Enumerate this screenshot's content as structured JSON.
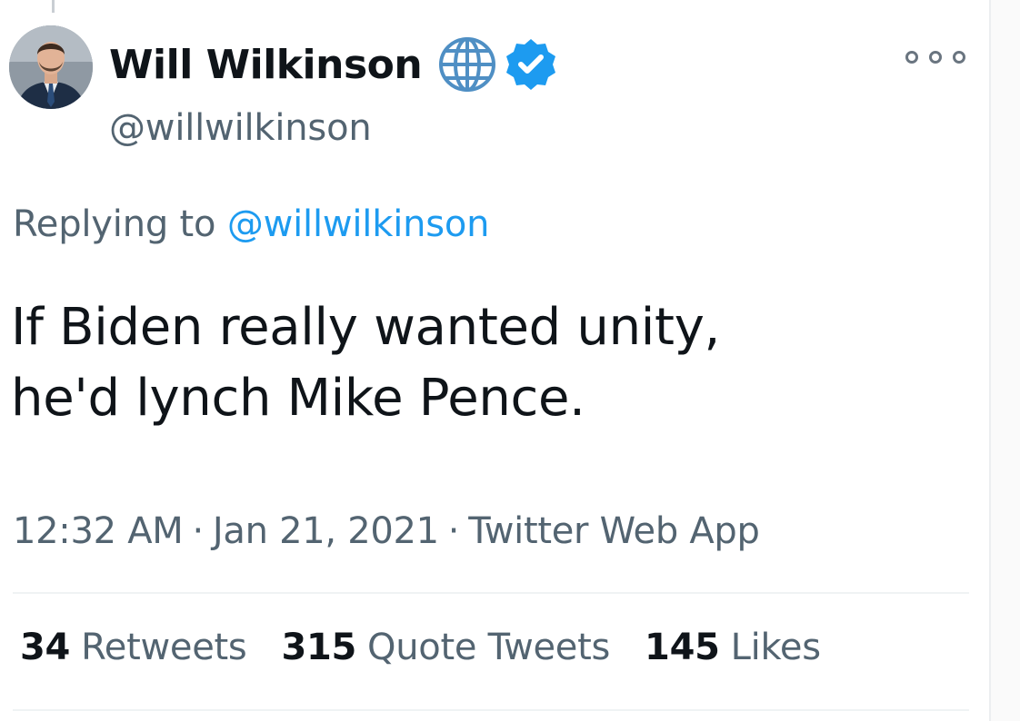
{
  "author": {
    "display_name": "Will Wilkinson",
    "handle": "@willwilkinson"
  },
  "icons": {
    "globe": "globe-icon",
    "verified": "verified-badge-icon",
    "more": "more-options-icon"
  },
  "reply": {
    "prefix": "Replying to",
    "target": "@willwilkinson"
  },
  "tweet": {
    "lines": [
      "If Biden really wanted unity,",
      "he'd lynch Mike Pence."
    ]
  },
  "meta": {
    "time": "12:32 AM",
    "separator": "·",
    "date": "Jan 21, 2021",
    "source": "Twitter Web App"
  },
  "stats": {
    "retweets": {
      "count": "34",
      "label": "Retweets"
    },
    "quotes": {
      "count": "315",
      "label": "Quote Tweets"
    },
    "likes": {
      "count": "145",
      "label": "Likes"
    }
  },
  "colors": {
    "text": "#0f1419",
    "secondary": "#536471",
    "accent": "#1d9bf0",
    "divider": "#eff3f4"
  }
}
